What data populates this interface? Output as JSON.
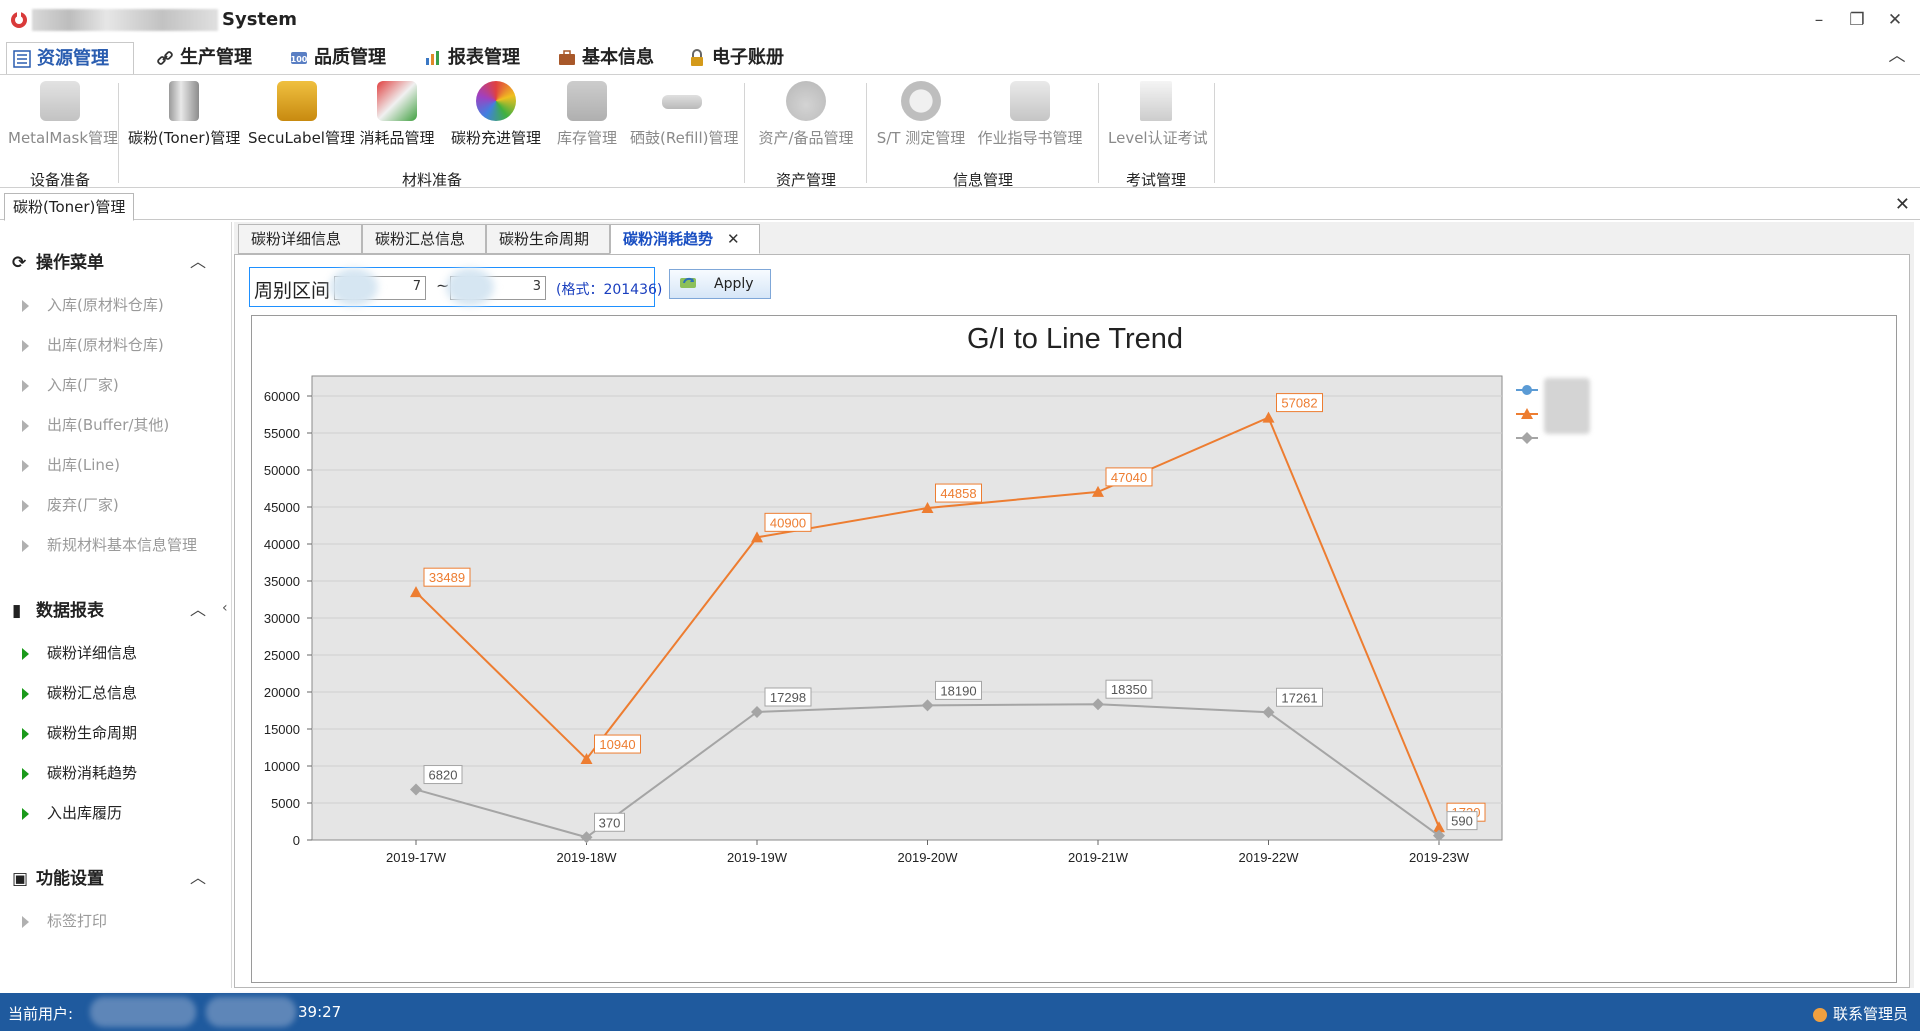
{
  "app": {
    "title": "System"
  },
  "window_controls": {
    "minimize": "–",
    "restore": "❐",
    "close": "✕"
  },
  "menu": {
    "tabs": [
      {
        "label": "资源管理",
        "icon": "list-icon"
      },
      {
        "label": "生产管理",
        "icon": "link-icon"
      },
      {
        "label": "品质管理",
        "icon": "quality-icon"
      },
      {
        "label": "报表管理",
        "icon": "bar-chart-icon"
      },
      {
        "label": "基本信息",
        "icon": "briefcase-icon"
      },
      {
        "label": "电子账册",
        "icon": "lock-icon"
      }
    ],
    "collapse": "︿"
  },
  "ribbon": {
    "buttons": [
      {
        "label": "MetalMask管理",
        "icon": "metal-mask-icon"
      },
      {
        "label": "碳粉(Toner)管理",
        "icon": "toner-icon"
      },
      {
        "label": "SecuLabel管理",
        "icon": "secu-label-icon"
      },
      {
        "label": "消耗品管理",
        "icon": "consumable-icon"
      },
      {
        "label": "碳粉充进管理",
        "icon": "toner-refill-icon"
      },
      {
        "label": "库存管理",
        "icon": "inventory-icon"
      },
      {
        "label": "硒鼓(Refill)管理",
        "icon": "drum-icon"
      },
      {
        "label": "资产/备品管理",
        "icon": "money-bag-icon"
      },
      {
        "label": "S/T 测定管理",
        "icon": "stopwatch-icon"
      },
      {
        "label": "作业指导书管理",
        "icon": "document-camera-icon"
      },
      {
        "label": "Level认证考试",
        "icon": "exam-icon"
      }
    ],
    "groups": [
      "设备准备",
      "材料准备",
      "资产管理",
      "信息管理",
      "考试管理"
    ]
  },
  "doc_tab": {
    "label": "碳粉(Toner)管理",
    "close": "✕"
  },
  "sidebar": {
    "groups": [
      {
        "label": "操作菜单",
        "items": [
          "入库(原材料仓库)",
          "出库(原材料仓库)",
          "入库(厂家)",
          "出库(Buffer/其他)",
          "出库(Line)",
          "废弃(厂家)",
          "新规材料基本信息管理"
        ]
      },
      {
        "label": "数据报表",
        "items": [
          "碳粉详细信息",
          "碳粉汇总信息",
          "碳粉生命周期",
          "碳粉消耗趋势",
          "入出库履历"
        ]
      },
      {
        "label": "功能设置",
        "items": [
          "标签打印"
        ]
      }
    ],
    "caret_up": "︿",
    "collapse_arrow": "‹"
  },
  "inner_tabs": [
    "碳粉详细信息",
    "碳粉汇总信息",
    "碳粉生命周期",
    "碳粉消耗趋势"
  ],
  "inner_close": "✕",
  "filter": {
    "label": "周别区间",
    "from_value": "7",
    "to_value": "3",
    "separator": "~",
    "hint": "(格式：201436)",
    "apply": "Apply"
  },
  "chart_data": {
    "type": "line",
    "title": "G/I to Line Trend",
    "categories": [
      "2019-17W",
      "2019-18W",
      "2019-19W",
      "2019-20W",
      "2019-21W",
      "2019-22W",
      "2019-23W"
    ],
    "ylim": [
      0,
      60000
    ],
    "yticks": [
      0,
      5000,
      10000,
      15000,
      20000,
      25000,
      30000,
      35000,
      40000,
      45000,
      50000,
      55000,
      60000
    ],
    "grid": true,
    "legend_position": "top-right",
    "series": [
      {
        "marker": "circle",
        "color": "#5b9bd5",
        "values": []
      },
      {
        "marker": "triangle",
        "color": "#ed7d31",
        "values": [
          33489,
          10940,
          40900,
          44858,
          47040,
          57082,
          1730
        ]
      },
      {
        "marker": "diamond",
        "color": "#a5a5a5",
        "values": [
          6820,
          370,
          17298,
          18190,
          18350,
          17261,
          590
        ]
      }
    ]
  },
  "status": {
    "label": "当前用户:",
    "time": "39:27",
    "admin": "联系管理员"
  }
}
